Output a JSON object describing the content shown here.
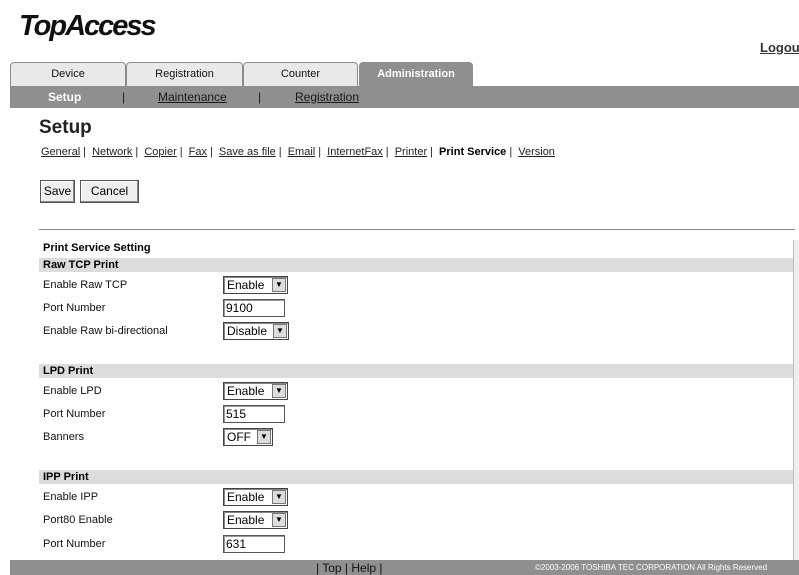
{
  "app": {
    "logo": "TopAccess",
    "logout": "Logout"
  },
  "tabs": [
    {
      "label": "Device"
    },
    {
      "label": "Registration"
    },
    {
      "label": "Counter"
    },
    {
      "label": "Administration",
      "active": true
    }
  ],
  "subnav": {
    "setup": "Setup",
    "maintenance": "Maintenance",
    "registration": "Registration",
    "sep": "|"
  },
  "page": {
    "title": "Setup",
    "links": [
      "General",
      "Network",
      "Copier",
      "Fax",
      "Save as file",
      "Email",
      "InternetFax",
      "Printer",
      "Print Service",
      "Version"
    ],
    "current_link": "Print Service"
  },
  "buttons": {
    "save": "Save",
    "cancel": "Cancel"
  },
  "form": {
    "title": "Print Service Setting",
    "raw": {
      "heading": "Raw TCP Print",
      "enable_label": "Enable Raw TCP",
      "enable_value": "Enable",
      "port_label": "Port Number",
      "port_value": "9100",
      "bidi_label": "Enable Raw bi-directional",
      "bidi_value": "Disable"
    },
    "lpd": {
      "heading": "LPD Print",
      "enable_label": "Enable LPD",
      "enable_value": "Enable",
      "port_label": "Port Number",
      "port_value": "515",
      "banners_label": "Banners",
      "banners_value": "OFF"
    },
    "ipp": {
      "heading": "IPP Print",
      "enable_label": "Enable IPP",
      "enable_value": "Enable",
      "port80_label": "Port80 Enable",
      "port80_value": "Enable",
      "port_label": "Port Number",
      "port_value": "631"
    }
  },
  "footer": {
    "nav": "| Top | Help |",
    "copyright": "©2003-2006 TOSHIBA TEC CORPORATION All Rights Reserved"
  },
  "icons": {
    "dropdown": "dropdown-arrow-icon"
  },
  "colors": {
    "tab_active": "#8f8f8f",
    "group_header": "#dcdcdc"
  }
}
